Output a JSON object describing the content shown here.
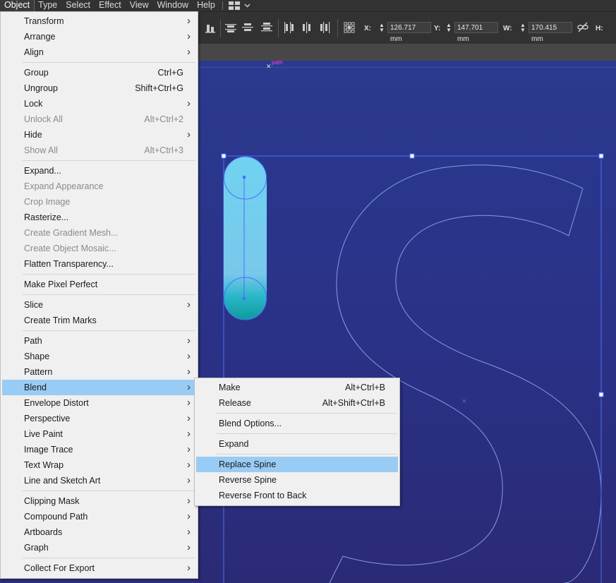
{
  "menubar": {
    "items": [
      "Object",
      "Type",
      "Select",
      "Effect",
      "View",
      "Window",
      "Help"
    ],
    "active": "Object"
  },
  "controlbar": {
    "x_label": "X:",
    "x_value": "126.717 mm",
    "y_label": "Y:",
    "y_value": "147.701 mm",
    "w_label": "W:",
    "w_value": "170.415 mm",
    "h_label": "H:"
  },
  "canvas": {
    "path_label": "path",
    "letter": "S",
    "accent_color": "#99ccf5",
    "selection_color": "#4d6cff"
  },
  "object_menu": {
    "groups": [
      [
        {
          "label": "Transform",
          "submenu": true
        },
        {
          "label": "Arrange",
          "submenu": true
        },
        {
          "label": "Align",
          "submenu": true
        }
      ],
      [
        {
          "label": "Group",
          "shortcut": "Ctrl+G"
        },
        {
          "label": "Ungroup",
          "shortcut": "Shift+Ctrl+G"
        },
        {
          "label": "Lock",
          "submenu": true
        },
        {
          "label": "Unlock All",
          "shortcut": "Alt+Ctrl+2",
          "disabled": true
        },
        {
          "label": "Hide",
          "submenu": true
        },
        {
          "label": "Show All",
          "shortcut": "Alt+Ctrl+3",
          "disabled": true
        }
      ],
      [
        {
          "label": "Expand..."
        },
        {
          "label": "Expand Appearance",
          "disabled": true
        },
        {
          "label": "Crop Image",
          "disabled": true
        },
        {
          "label": "Rasterize..."
        },
        {
          "label": "Create Gradient Mesh...",
          "disabled": true
        },
        {
          "label": "Create Object Mosaic...",
          "disabled": true
        },
        {
          "label": "Flatten Transparency..."
        }
      ],
      [
        {
          "label": "Make Pixel Perfect"
        }
      ],
      [
        {
          "label": "Slice",
          "submenu": true
        },
        {
          "label": "Create Trim Marks"
        }
      ],
      [
        {
          "label": "Path",
          "submenu": true
        },
        {
          "label": "Shape",
          "submenu": true
        },
        {
          "label": "Pattern",
          "submenu": true
        },
        {
          "label": "Blend",
          "submenu": true,
          "highlighted": true
        },
        {
          "label": "Envelope Distort",
          "submenu": true
        },
        {
          "label": "Perspective",
          "submenu": true
        },
        {
          "label": "Live Paint",
          "submenu": true
        },
        {
          "label": "Image Trace",
          "submenu": true
        },
        {
          "label": "Text Wrap",
          "submenu": true
        },
        {
          "label": "Line and Sketch Art",
          "submenu": true
        }
      ],
      [
        {
          "label": "Clipping Mask",
          "submenu": true
        },
        {
          "label": "Compound Path",
          "submenu": true
        },
        {
          "label": "Artboards",
          "submenu": true
        },
        {
          "label": "Graph",
          "submenu": true
        }
      ],
      [
        {
          "label": "Collect For Export",
          "submenu": true
        }
      ]
    ]
  },
  "blend_menu": {
    "groups": [
      [
        {
          "label": "Make",
          "shortcut": "Alt+Ctrl+B"
        },
        {
          "label": "Release",
          "shortcut": "Alt+Shift+Ctrl+B"
        }
      ],
      [
        {
          "label": "Blend Options..."
        }
      ],
      [
        {
          "label": "Expand"
        }
      ],
      [
        {
          "label": "Replace Spine",
          "highlighted": true
        },
        {
          "label": "Reverse Spine"
        },
        {
          "label": "Reverse Front to Back"
        }
      ]
    ]
  }
}
